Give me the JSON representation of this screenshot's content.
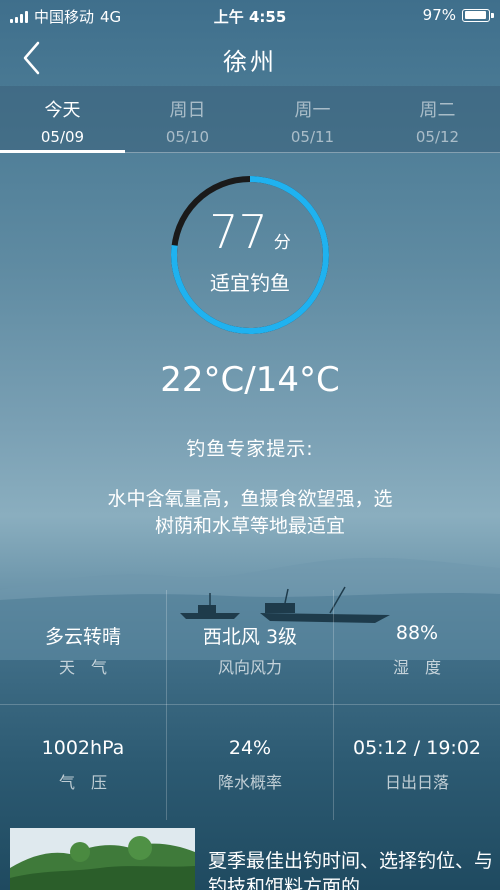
{
  "status_bar": {
    "carrier": "中国移动",
    "network": "4G",
    "time": "上午 4:55",
    "battery_text": "97%",
    "battery_level": 0.97
  },
  "nav": {
    "title": "徐州",
    "back_icon": "chevron-left-icon"
  },
  "tabs": [
    {
      "day": "今天",
      "date": "05/09",
      "active": true
    },
    {
      "day": "周日",
      "date": "05/10",
      "active": false
    },
    {
      "day": "周一",
      "date": "05/11",
      "active": false
    },
    {
      "day": "周二",
      "date": "05/12",
      "active": false
    }
  ],
  "score": {
    "value": "77",
    "unit": "分",
    "label": "适宜钓鱼",
    "progress": 0.77,
    "accent_color": "#1fb2f0",
    "track_color": "#1a1a1a"
  },
  "temperature": "22°C/14°C",
  "tip": {
    "title": "钓鱼专家提示:",
    "text": "水中含氧量高，鱼摄食欲望强，选树荫和水草等地最适宜"
  },
  "info": [
    {
      "value": "多云转晴",
      "label": "天　气"
    },
    {
      "value": "西北风 3级",
      "label": "风向风力"
    },
    {
      "value": "88%",
      "label": "湿　度"
    },
    {
      "value": "1002hPa",
      "label": "气　压"
    },
    {
      "value": "24%",
      "label": "降水概率"
    },
    {
      "value": "05:12 / 19:02",
      "label": "日出日落"
    }
  ],
  "article": {
    "title": "夏季最佳出钓时间、选择钓位、与钓技和饵料方面的..."
  }
}
